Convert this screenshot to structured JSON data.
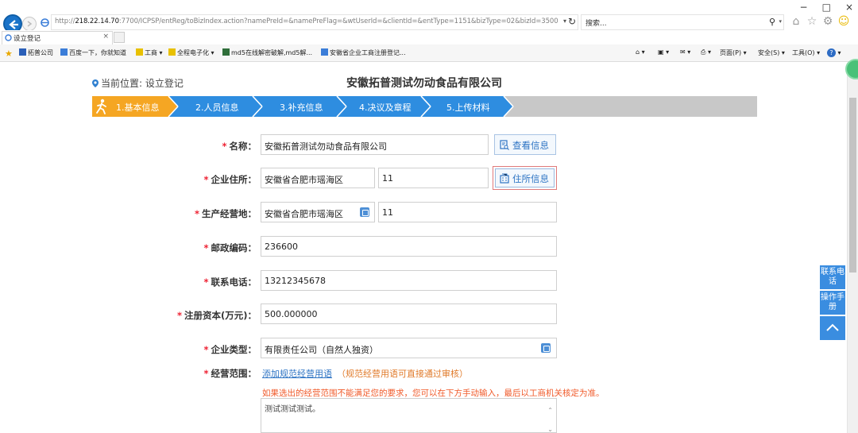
{
  "browser": {
    "url_prefix": "http://",
    "url_host": "218.22.14.70",
    "url_rest": ":7700/ICPSP/entReg/toBizIndex.action?namePreId=&namePreFlag=&wtUserId=&clientId=&entType=1151&bizType=02&bizId=3500",
    "search_placeholder": "搜索...",
    "tab_title": "设立登记",
    "tab_close": "×",
    "win_minimize": "−",
    "win_restore": "□",
    "win_close": "×"
  },
  "favorites": [
    {
      "label": "拓普公司",
      "color": "#2a5fb8"
    },
    {
      "label": "百度一下，你就知道",
      "color": "#3b7dd8"
    },
    {
      "label": "工商 ▾",
      "color": "#e8c000"
    },
    {
      "label": "全程电子化 ▾",
      "color": "#e8c000"
    },
    {
      "label": "md5在线解密破解,md5解...",
      "color": "#2f6e3a"
    },
    {
      "label": "安徽省企业工商注册登记...",
      "color": "#3b7dd8"
    }
  ],
  "commands": {
    "page": "页面(P) ▾",
    "safety": "安全(S) ▾",
    "tools": "工具(O) ▾"
  },
  "page": {
    "location": "当前位置: 设立登记",
    "company_title": "安徽拓普测试勿动食品有限公司",
    "steps": [
      {
        "label": "1.基本信息",
        "active": true
      },
      {
        "label": "2.人员信息",
        "active": false
      },
      {
        "label": "3.补充信息",
        "active": false
      },
      {
        "label": "4.决议及章程",
        "active": false
      },
      {
        "label": "5.上传材料",
        "active": false
      }
    ],
    "form": {
      "name_label": "名称：",
      "name_value": "安徽拓普测试勿动食品有限公司",
      "view_info_button": "查看信息",
      "address_label": "企业住所：",
      "address_region": "安徽省合肥市瑶海区",
      "address_detail": "11",
      "address_info_button": "住所信息",
      "business_place_label": "生产经营地：",
      "business_place_region": "安徽省合肥市瑶海区",
      "business_place_detail": "11",
      "postcode_label": "邮政编码：",
      "postcode_value": "236600",
      "phone_label": "联系电话：",
      "phone_value": "13212345678",
      "capital_label": "注册资本(万元)：",
      "capital_value": "500.000000",
      "type_label": "企业类型：",
      "type_value": "有限责任公司（自然人独资）",
      "scope_label": "经营范围：",
      "scope_link": "添加规范经营用语",
      "scope_hint": "（规范经营用语可直接通过审核）",
      "scope_warning": "如果选出的经营范围不能满足您的要求，您可以在下方手动输入，最后以工商机关核定为准。",
      "scope_text": "测试测试测试。",
      "required_mark": "*"
    },
    "floating": {
      "contact": "联系电话",
      "manual": "操作手册"
    }
  }
}
